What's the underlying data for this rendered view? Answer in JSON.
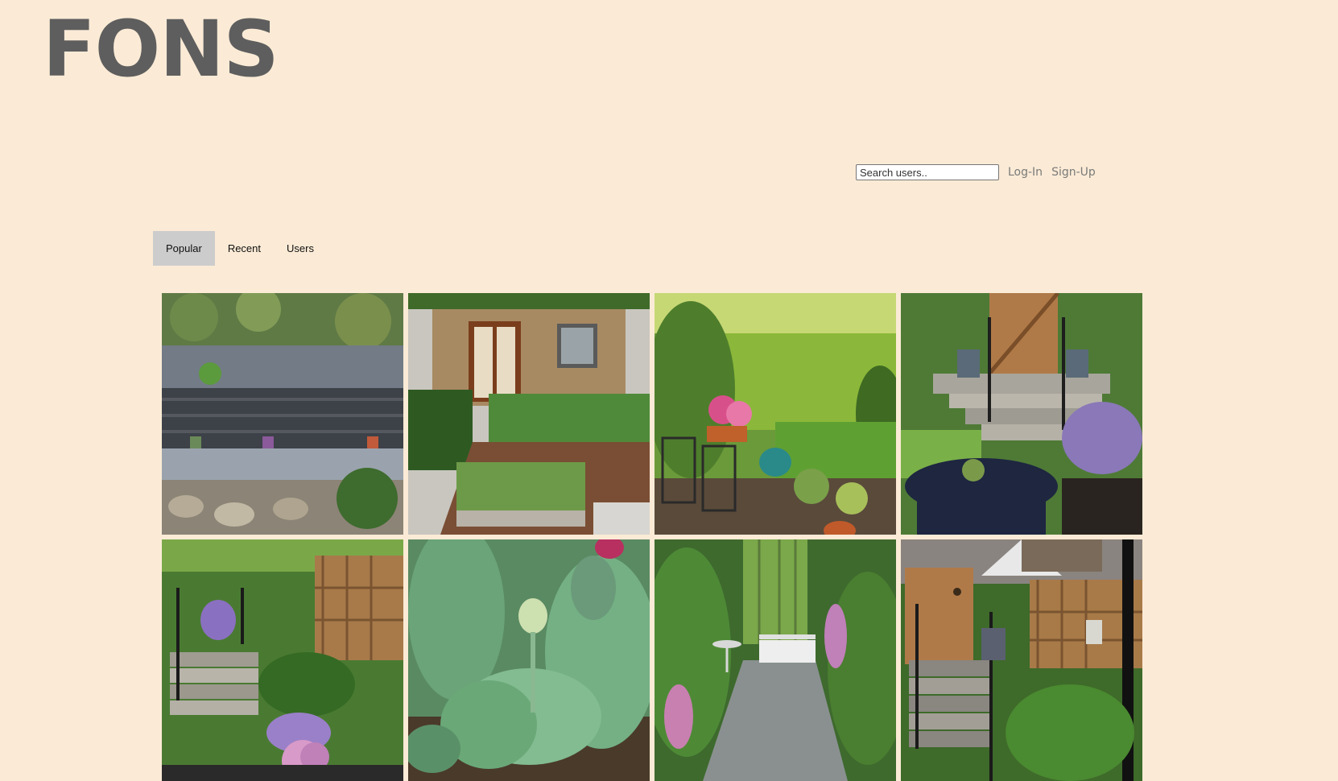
{
  "logo": "FONS",
  "header": {
    "search_placeholder": "Search users..",
    "login_label": "Log-In",
    "signup_label": "Sign-Up"
  },
  "tabs": [
    {
      "label": "Popular",
      "active": true
    },
    {
      "label": "Recent",
      "active": false
    },
    {
      "label": "Users",
      "active": false
    }
  ],
  "gallery": {
    "images": [
      {
        "subject": "raised planter wall garden"
      },
      {
        "subject": "patio with deck and planter"
      },
      {
        "subject": "hedged garden with bistro chairs"
      },
      {
        "subject": "garden steps with wooden gate"
      },
      {
        "subject": "stepped garden with lavender"
      },
      {
        "subject": "tulip leaves close-up"
      },
      {
        "subject": "shaded garden with white bench"
      },
      {
        "subject": "wooden gate with trellis fence"
      }
    ]
  },
  "colors": {
    "background": "#fbebd6",
    "logo": "#5e5e5e",
    "active_tab": "#cccccc",
    "link": "#7a7a7a"
  }
}
